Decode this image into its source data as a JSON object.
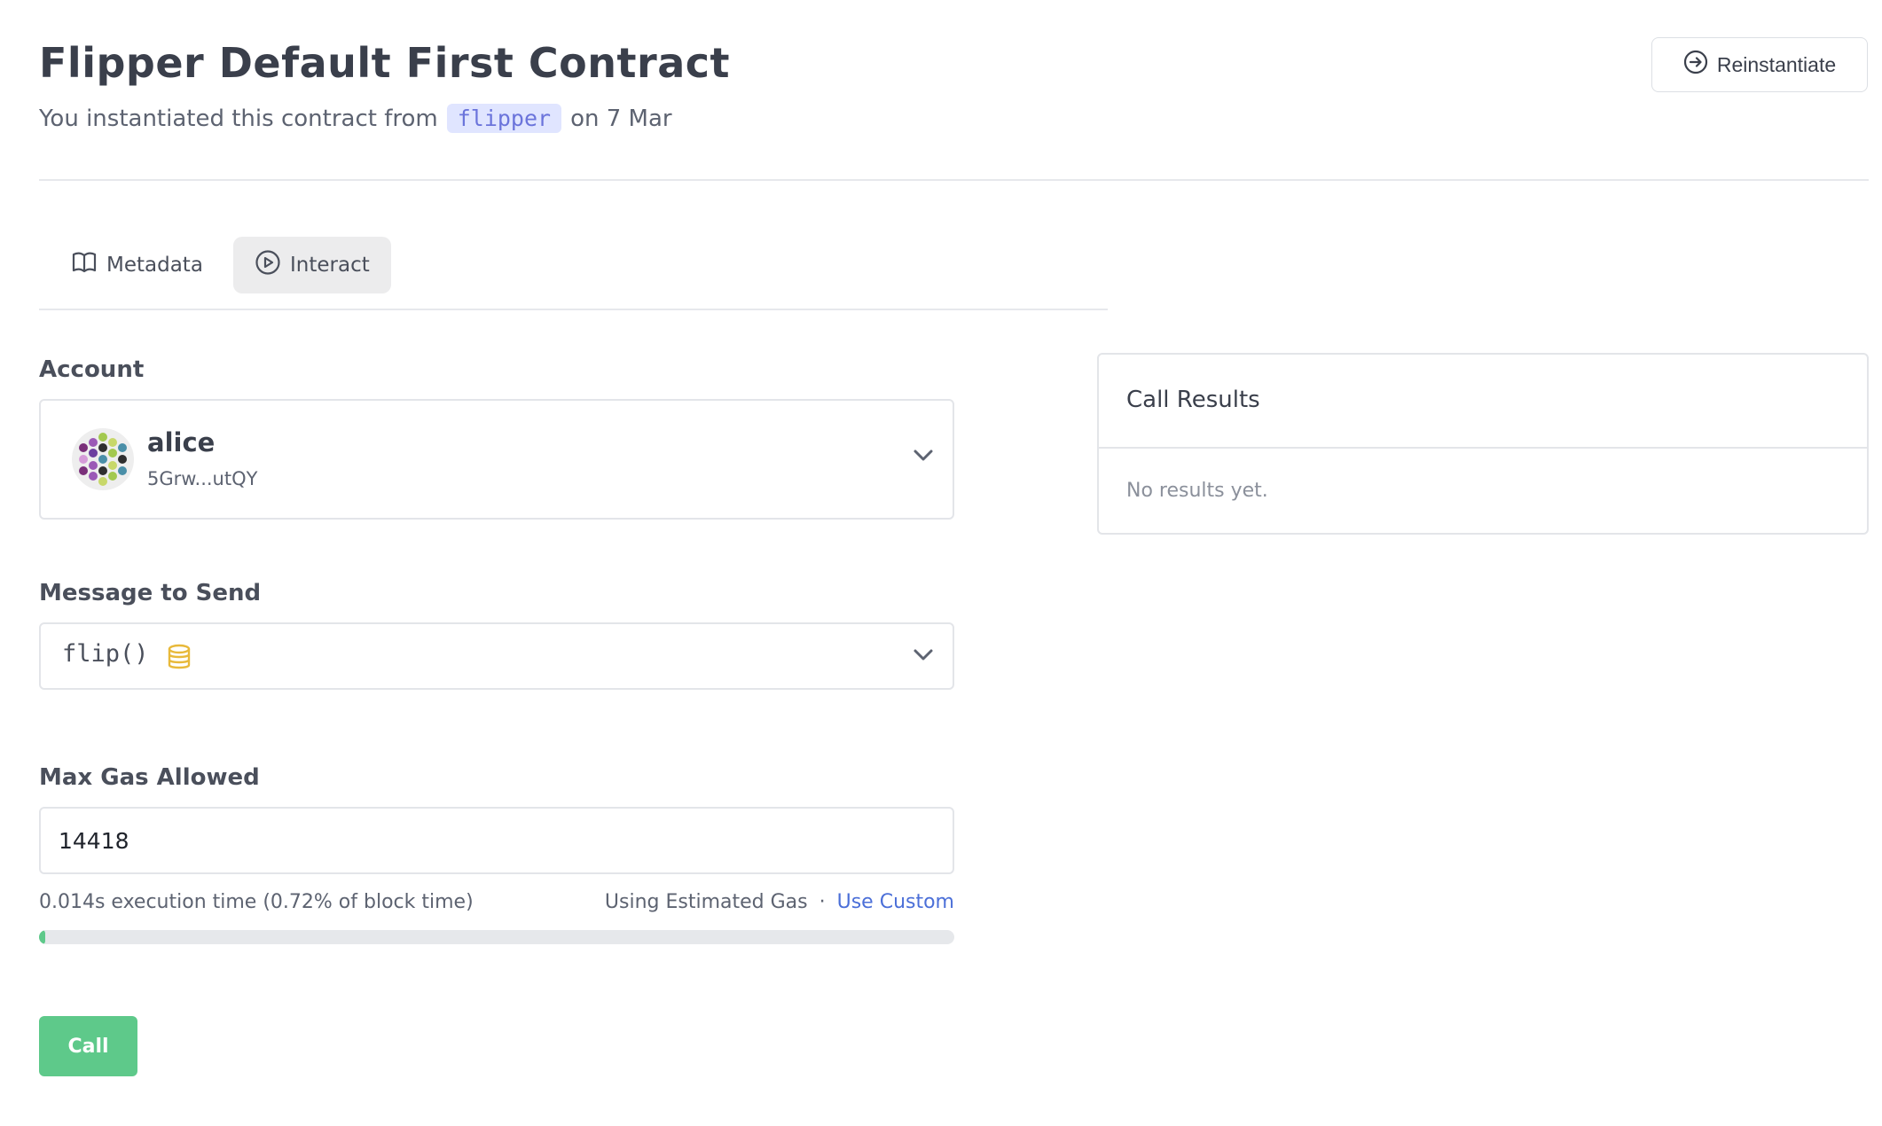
{
  "header": {
    "title": "Flipper Default First Contract",
    "subtitle_prefix": "You instantiated this contract from",
    "code_name": "flipper",
    "subtitle_suffix": "on 7 Mar",
    "reinstantiate_label": "Reinstantiate"
  },
  "tabs": [
    {
      "label": "Metadata",
      "icon": "book-icon",
      "active": false
    },
    {
      "label": "Interact",
      "icon": "play-circle-icon",
      "active": true
    }
  ],
  "form": {
    "account": {
      "label": "Account",
      "name": "alice",
      "address": "5Grw...utQY",
      "avatar_colors": [
        "#7a2f7a",
        "#9b59b6",
        "#6c3fa0",
        "#a3c94f",
        "#2f2f2f",
        "#4a8fa8",
        "#d59bd9",
        "#c8d86a"
      ]
    },
    "message": {
      "label": "Message to Send",
      "value": "flip()",
      "icon": "database-icon",
      "icon_color": "#e8b93a"
    },
    "gas": {
      "label": "Max Gas Allowed",
      "value": "14418",
      "execution_note": "0.014s execution time (0.72% of block time)",
      "estimated_label": "Using Estimated Gas",
      "separator": "·",
      "custom_link": "Use Custom",
      "progress_percent": 0.72
    },
    "call_label": "Call"
  },
  "results": {
    "title": "Call Results",
    "empty_text": "No results yet."
  },
  "colors": {
    "accent_green": "#5ec98a",
    "link_blue": "#4b6fd8",
    "code_bg": "#e0e5ff",
    "code_text": "#6b74db"
  }
}
